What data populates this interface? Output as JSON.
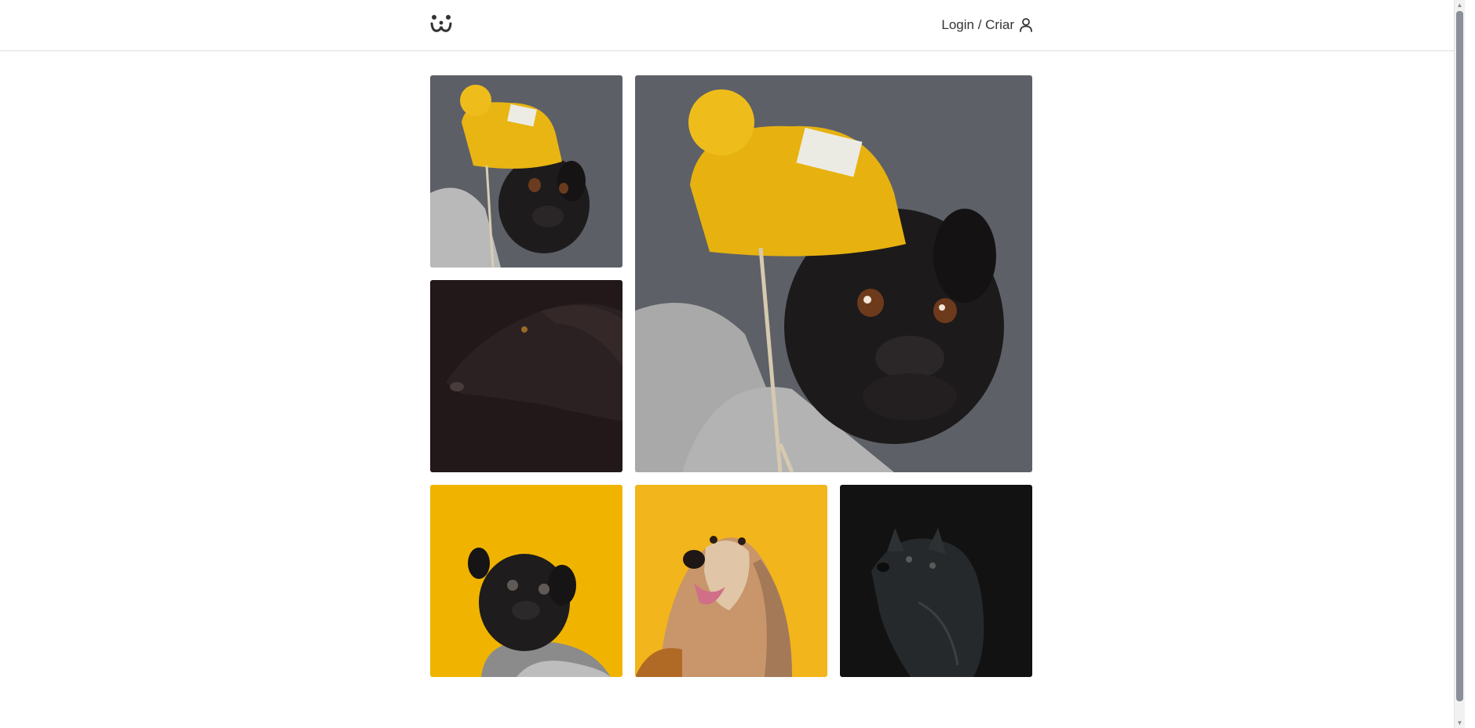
{
  "header": {
    "login_label": "Login / Criar",
    "logo_icon": "dog-face-icon",
    "user_icon": "user-icon"
  },
  "feed": {
    "photos": [
      {
        "subject": "pug with yellow beanie (thumbnail)",
        "bg": "#5f6168"
      },
      {
        "subject": "pug with yellow beanie (large)",
        "bg": "#5f6168"
      },
      {
        "subject": "black labrador in shadow",
        "bg": "#221819"
      },
      {
        "subject": "black pug with grey sweater on yellow",
        "bg": "#f0b400"
      },
      {
        "subject": "afghan hound on yellow",
        "bg": "#f2b51b"
      },
      {
        "subject": "black spitz dog in dark",
        "bg": "#121212"
      }
    ]
  },
  "colors": {
    "accent_yellow": "#f0b400",
    "text": "#333333",
    "divider": "#e6e6e6"
  }
}
